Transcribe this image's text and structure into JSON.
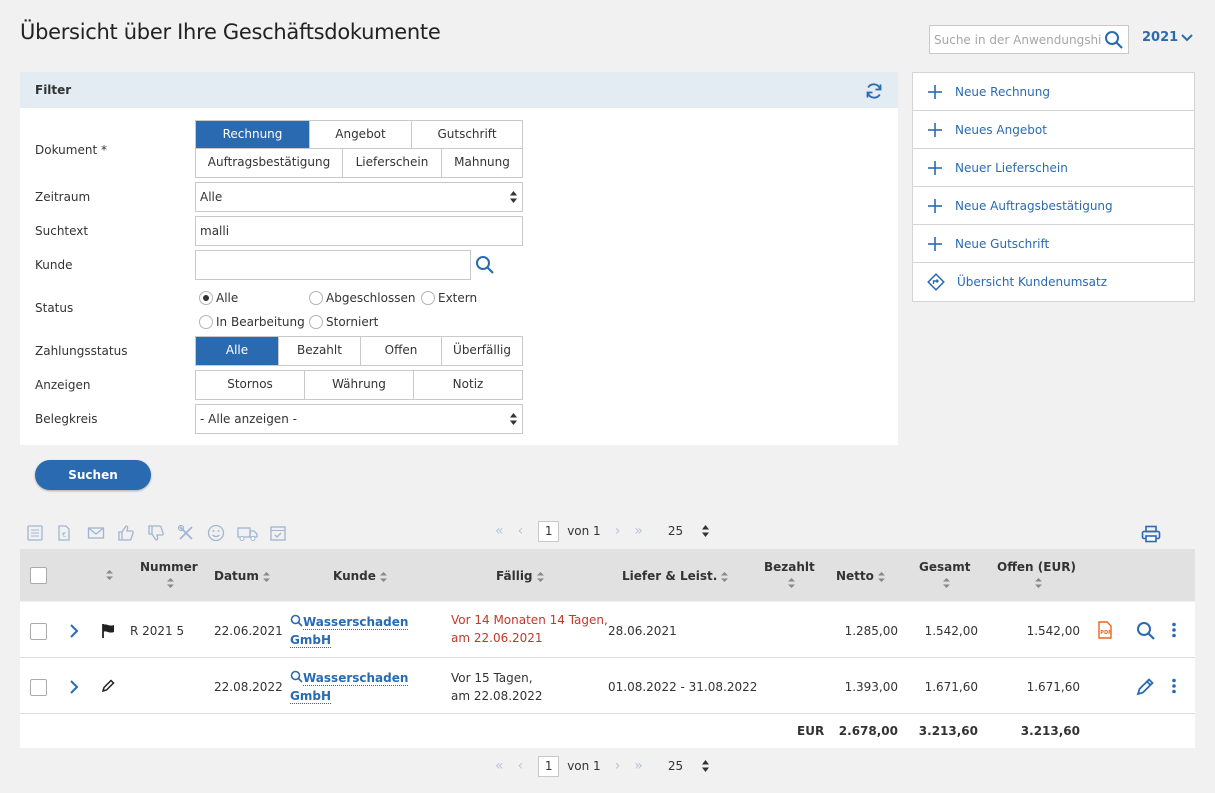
{
  "header": {
    "title": "Übersicht über Ihre Geschäftsdokumente",
    "search_placeholder": "Suche in der Anwendungshilfe",
    "year": "2021"
  },
  "filter": {
    "title": "Filter",
    "dokument_label": "Dokument *",
    "dokument_options_row1": [
      "Rechnung",
      "Angebot",
      "Gutschrift"
    ],
    "dokument_options_row2": [
      "Auftragsbestätigung",
      "Lieferschein",
      "Mahnung"
    ],
    "dokument_selected": "Rechnung",
    "zeitraum_label": "Zeitraum",
    "zeitraum_value": "Alle",
    "suchtext_label": "Suchtext",
    "suchtext_value": "malli",
    "kunde_label": "Kunde",
    "kunde_value": "",
    "status_label": "Status",
    "status_options": [
      "Alle",
      "Abgeschlossen",
      "Extern",
      "In Bearbeitung",
      "Storniert"
    ],
    "status_selected": "Alle",
    "zahlungsstatus_label": "Zahlungsstatus",
    "zahlungsstatus_options": [
      "Alle",
      "Bezahlt",
      "Offen",
      "Überfällig"
    ],
    "zahlungsstatus_selected": "Alle",
    "anzeigen_label": "Anzeigen",
    "anzeigen_options": [
      "Stornos",
      "Währung",
      "Notiz"
    ],
    "belegkreis_label": "Belegkreis",
    "belegkreis_value": "- Alle anzeigen -"
  },
  "actions": [
    {
      "label": "Neue Rechnung",
      "icon": "plus-icon"
    },
    {
      "label": "Neues Angebot",
      "icon": "plus-icon"
    },
    {
      "label": "Neuer Lieferschein",
      "icon": "plus-icon"
    },
    {
      "label": "Neue Auftragsbestätigung",
      "icon": "plus-icon"
    },
    {
      "label": "Neue Gutschrift",
      "icon": "plus-icon"
    },
    {
      "label": "Übersicht Kundenumsatz",
      "icon": "route-icon"
    }
  ],
  "search_button": "Suchen",
  "pager": {
    "page": "1",
    "of_label": "von 1",
    "page_size": "25"
  },
  "table": {
    "columns": {
      "nummer": "Nummer",
      "datum": "Datum",
      "kunde": "Kunde",
      "faellig": "Fällig",
      "liefer": "Liefer & Leist.",
      "bezahlt": "Bezahlt",
      "netto": "Netto",
      "gesamt": "Gesamt",
      "offen": "Offen (EUR)"
    },
    "rows": [
      {
        "nummer": "R 2021 5",
        "datum": "22.06.2021",
        "kunde_1": "Wasserschaden",
        "kunde_2": "GmbH",
        "faellig_1": "Vor 14 Monaten 14 Tagen,",
        "faellig_2": "am 22.06.2021",
        "faellig_overdue": true,
        "liefer": "28.06.2021",
        "bezahlt": "",
        "netto": "1.285,00",
        "gesamt": "1.542,00",
        "offen": "1.542,00"
      },
      {
        "nummer": "",
        "datum": "22.08.2022",
        "kunde_1": "Wasserschaden",
        "kunde_2": "GmbH",
        "faellig_1": "Vor 15 Tagen,",
        "faellig_2": "am 22.08.2022",
        "faellig_overdue": false,
        "liefer": "01.08.2022 - 31.08.2022",
        "bezahlt": "",
        "netto": "1.393,00",
        "gesamt": "1.671,60",
        "offen": "1.671,60"
      }
    ],
    "totals": {
      "currency": "EUR",
      "netto": "2.678,00",
      "gesamt": "3.213,60",
      "offen": "3.213,60"
    }
  },
  "colors": {
    "accent": "#2a6ab0",
    "overdue": "#c0392b",
    "pdf": "#e8651d"
  }
}
